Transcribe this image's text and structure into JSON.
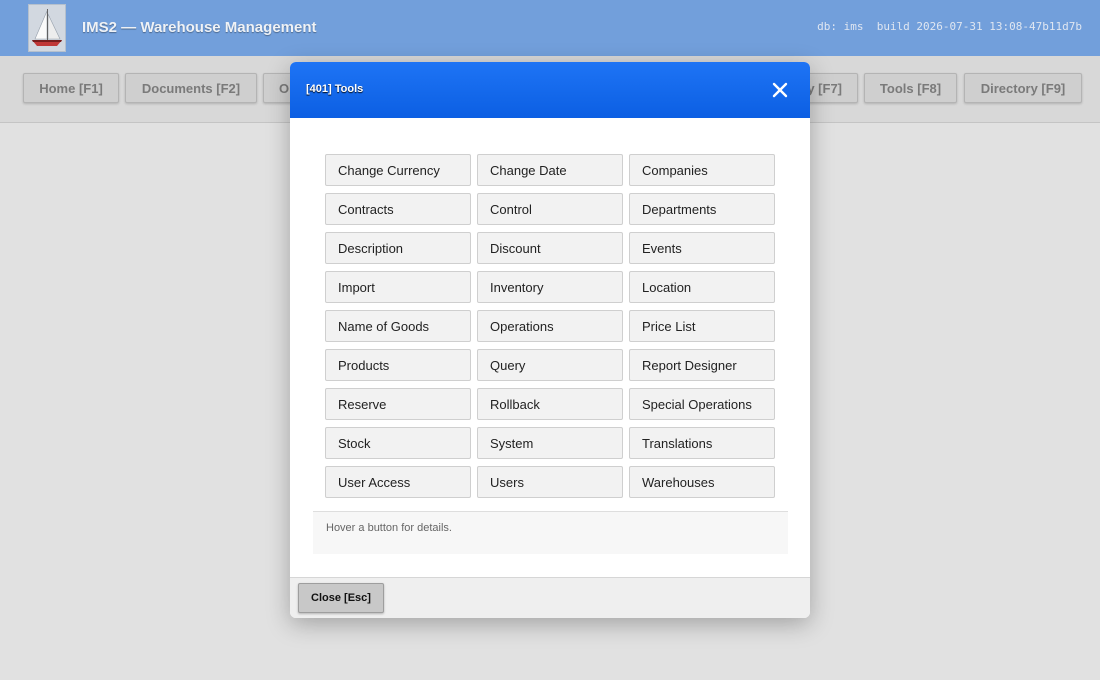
{
  "app": {
    "title": "IMS2 — Warehouse Management",
    "info": "db: ims  build 2026-07-31 13:08-47b11d7b",
    "logo_icon": "sailboat-icon"
  },
  "nav": {
    "items": [
      {
        "label": "Home [F1]"
      },
      {
        "label": "Documents [F2]"
      },
      {
        "label": "O"
      },
      {
        "label": "y [F7]"
      },
      {
        "label": "Tools [F8]"
      },
      {
        "label": "Directory [F9]"
      }
    ]
  },
  "modal": {
    "title": "[401] Tools",
    "close_icon": "close-icon",
    "header_color": "#0f64ea",
    "buttons": [
      "Change Currency",
      "Change Date",
      "Companies",
      "Contracts",
      "Control",
      "Departments",
      "Description",
      "Discount",
      "Events",
      "Import",
      "Inventory",
      "Location",
      "Name of Goods",
      "Operations",
      "Price List",
      "Products",
      "Query",
      "Report Designer",
      "Reserve",
      "Rollback",
      "Special Operations",
      "Stock",
      "System",
      "Translations",
      "User Access",
      "Users",
      "Warehouses"
    ],
    "hint": "Hover a button for details.",
    "close_button": "Close [Esc]"
  }
}
